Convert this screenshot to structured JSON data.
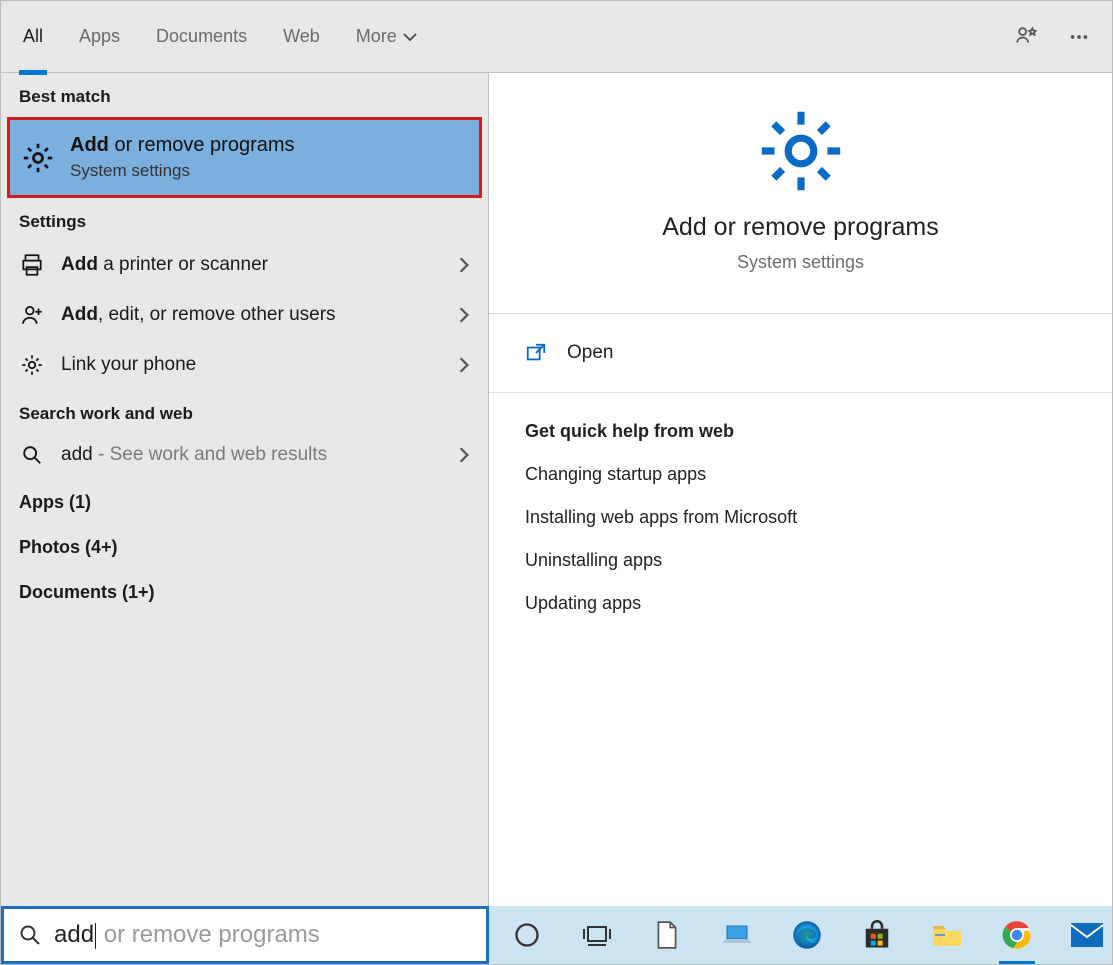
{
  "tabs": {
    "all": "All",
    "apps": "Apps",
    "documents": "Documents",
    "web": "Web",
    "more": "More"
  },
  "sections": {
    "best_match": "Best match",
    "settings": "Settings",
    "search_web": "Search work and web"
  },
  "best_match_item": {
    "title_bold": "Add",
    "title_rest": " or remove programs",
    "subtitle": "System settings"
  },
  "settings_items": [
    {
      "bold": "Add",
      "rest": " a printer or scanner",
      "icon": "printer"
    },
    {
      "bold": "Add",
      "rest": ", edit, or remove other users",
      "icon": "person-plus"
    },
    {
      "bold": "",
      "rest": "Link your phone",
      "icon": "gear"
    }
  ],
  "web_item": {
    "bold": "add",
    "rest": " - See work and web results"
  },
  "categories": [
    {
      "label": "Apps (1)"
    },
    {
      "label": "Photos (4+)"
    },
    {
      "label": "Documents (1+)"
    }
  ],
  "preview": {
    "title": "Add or remove programs",
    "subtitle": "System settings",
    "open": "Open"
  },
  "help": {
    "title": "Get quick help from web",
    "links": [
      "Changing startup apps",
      "Installing web apps from Microsoft",
      "Uninstalling apps",
      "Updating apps"
    ]
  },
  "search": {
    "typed": "add",
    "ghost": " or remove programs"
  },
  "taskbar_icons": [
    "cortana",
    "task-view",
    "document",
    "laptop",
    "edge",
    "store",
    "file-explorer",
    "chrome",
    "mail"
  ]
}
